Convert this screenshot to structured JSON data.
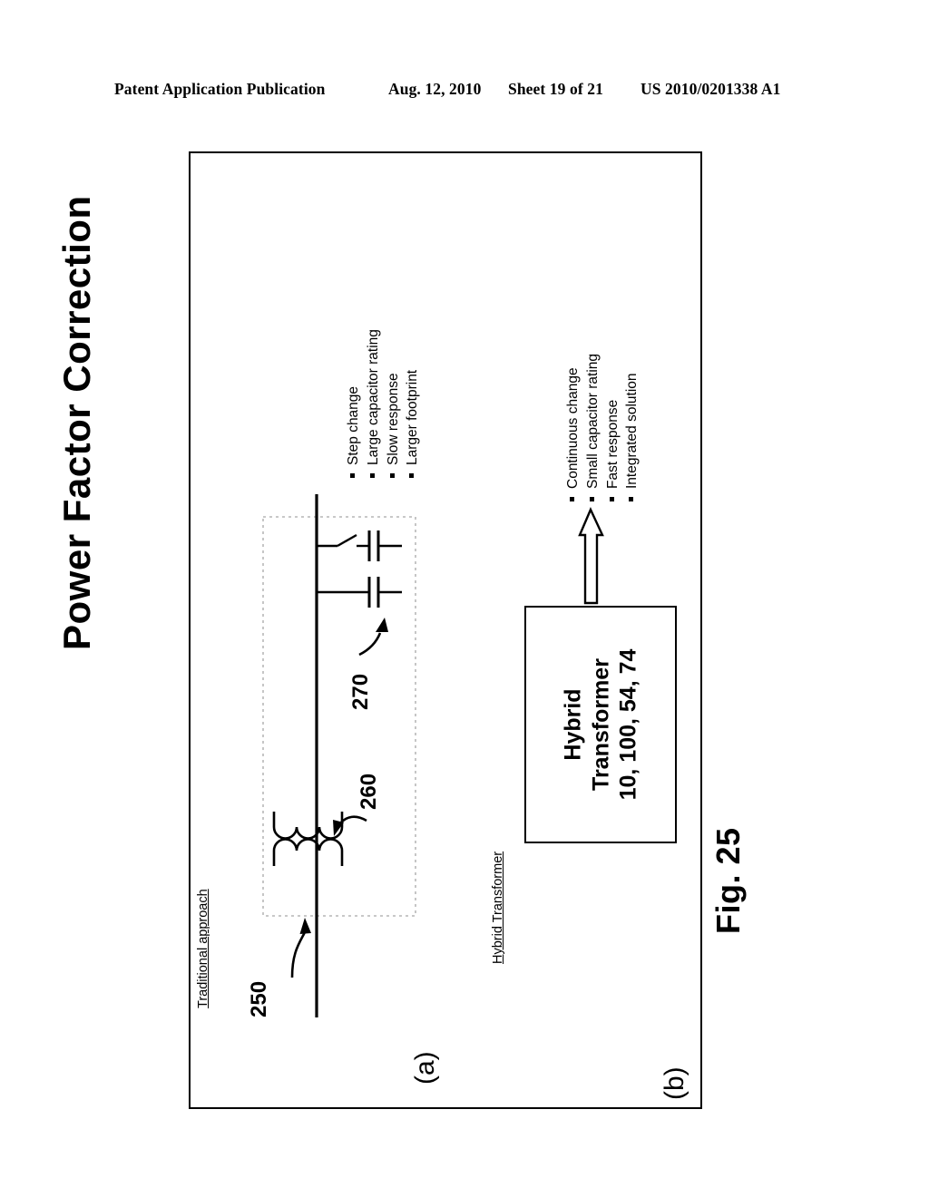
{
  "header": {
    "publication": "Patent Application Publication",
    "date": "Aug. 12, 2010",
    "sheet": "Sheet 19 of 21",
    "patent_number": "US 2010/0201338 A1"
  },
  "figure": {
    "caption": "Fig. 25",
    "title": "Power Factor Correction",
    "panels": [
      {
        "letter": "(a)",
        "section_label": "Traditional approach"
      },
      {
        "letter": "(b)",
        "section_label": "Hybrid Transformer"
      }
    ]
  },
  "panel_a": {
    "section_label": "Traditional approach",
    "panel_letter": "(a)",
    "ref_numerals": [
      {
        "id": "250",
        "points_to": "transformer"
      },
      {
        "id": "260",
        "points_to": "transformer-winding"
      },
      {
        "id": "270",
        "points_to": "capacitor-bank"
      }
    ],
    "bullets": [
      "Step change",
      "Large capacitor rating",
      "Slow response",
      "Larger footprint"
    ]
  },
  "panel_b": {
    "section_label": "Hybrid Transformer",
    "panel_letter": "(b)",
    "box": {
      "line1": "Hybrid",
      "line2": "Transformer",
      "line3": "10, 100, 54, 74"
    },
    "bullets": [
      "Continuous change",
      "Small capacitor rating",
      "Fast response",
      "Integrated solution"
    ]
  },
  "colors": {
    "ink": "#000000",
    "paper": "#ffffff",
    "dashed_guide": "#9a9a9a"
  }
}
